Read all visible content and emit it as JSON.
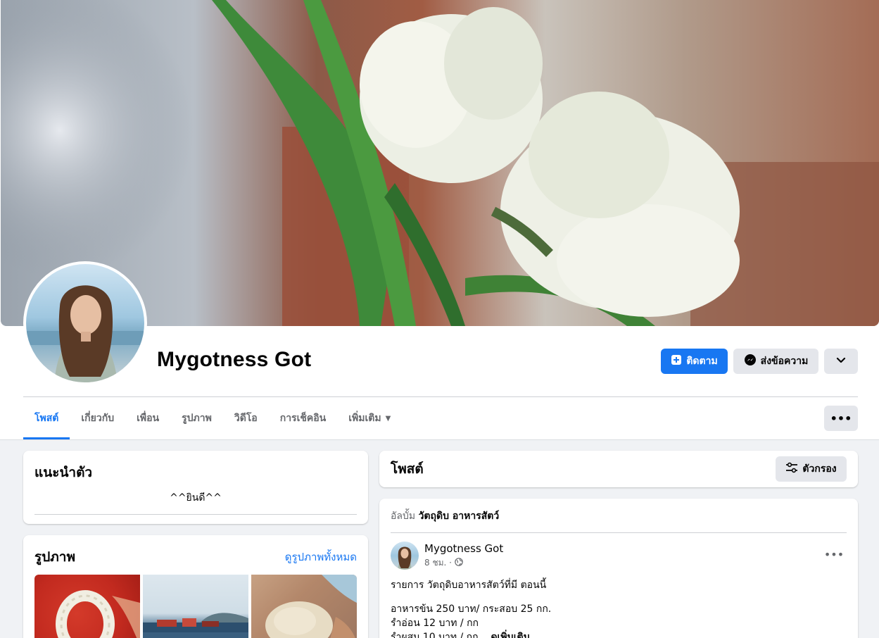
{
  "profile": {
    "name": "Mygotness Got",
    "follow_label": "ติดตาม",
    "message_label": "ส่งข้อความ"
  },
  "tabs": [
    {
      "label": "โพสต์",
      "active": true
    },
    {
      "label": "เกี่ยวกับ"
    },
    {
      "label": "เพื่อน"
    },
    {
      "label": "รูปภาพ"
    },
    {
      "label": "วิดีโอ"
    },
    {
      "label": "การเช็คอิน"
    },
    {
      "label": "เพิ่มเติม"
    }
  ],
  "intro": {
    "title": "แนะนำตัว",
    "bio": "^^ยินดี^^"
  },
  "photos": {
    "title": "รูปภาพ",
    "see_all": "ดูรูปภาพทั้งหมด"
  },
  "posts": {
    "title": "โพสต์",
    "filter_label": "ตัวกรอง"
  },
  "post": {
    "album_prefix": "อัลบั้ม",
    "album_name": "วัตถุดิบ อาหารสัตว์",
    "author": "Mygotness Got",
    "time": "8 ชม. ·",
    "line1": "รายการ วัตถุดิบอาหารสัตว์ที่มี ตอนนี้",
    "line2": "อาหารข้น 250 บาท/ กระสอบ 25 กก.",
    "line3": "รำอ่อน 12 บาท / กก",
    "line4": "รำผสม 10 บาท  / กก...",
    "see_more": "ดูเพิ่มเติม"
  },
  "icons": {
    "follow": "follow-plus-icon",
    "message": "messenger-icon",
    "more": "chevron-down-icon",
    "tab_more": "caret-down-icon",
    "dots": "more-dots-icon",
    "filter": "filter-sliders-icon",
    "privacy": "globe-icon"
  },
  "colors": {
    "accent": "#1877f2",
    "page_bg": "#f0f2f5",
    "button_gray": "#e4e6eb",
    "muted_text": "#65676b"
  }
}
